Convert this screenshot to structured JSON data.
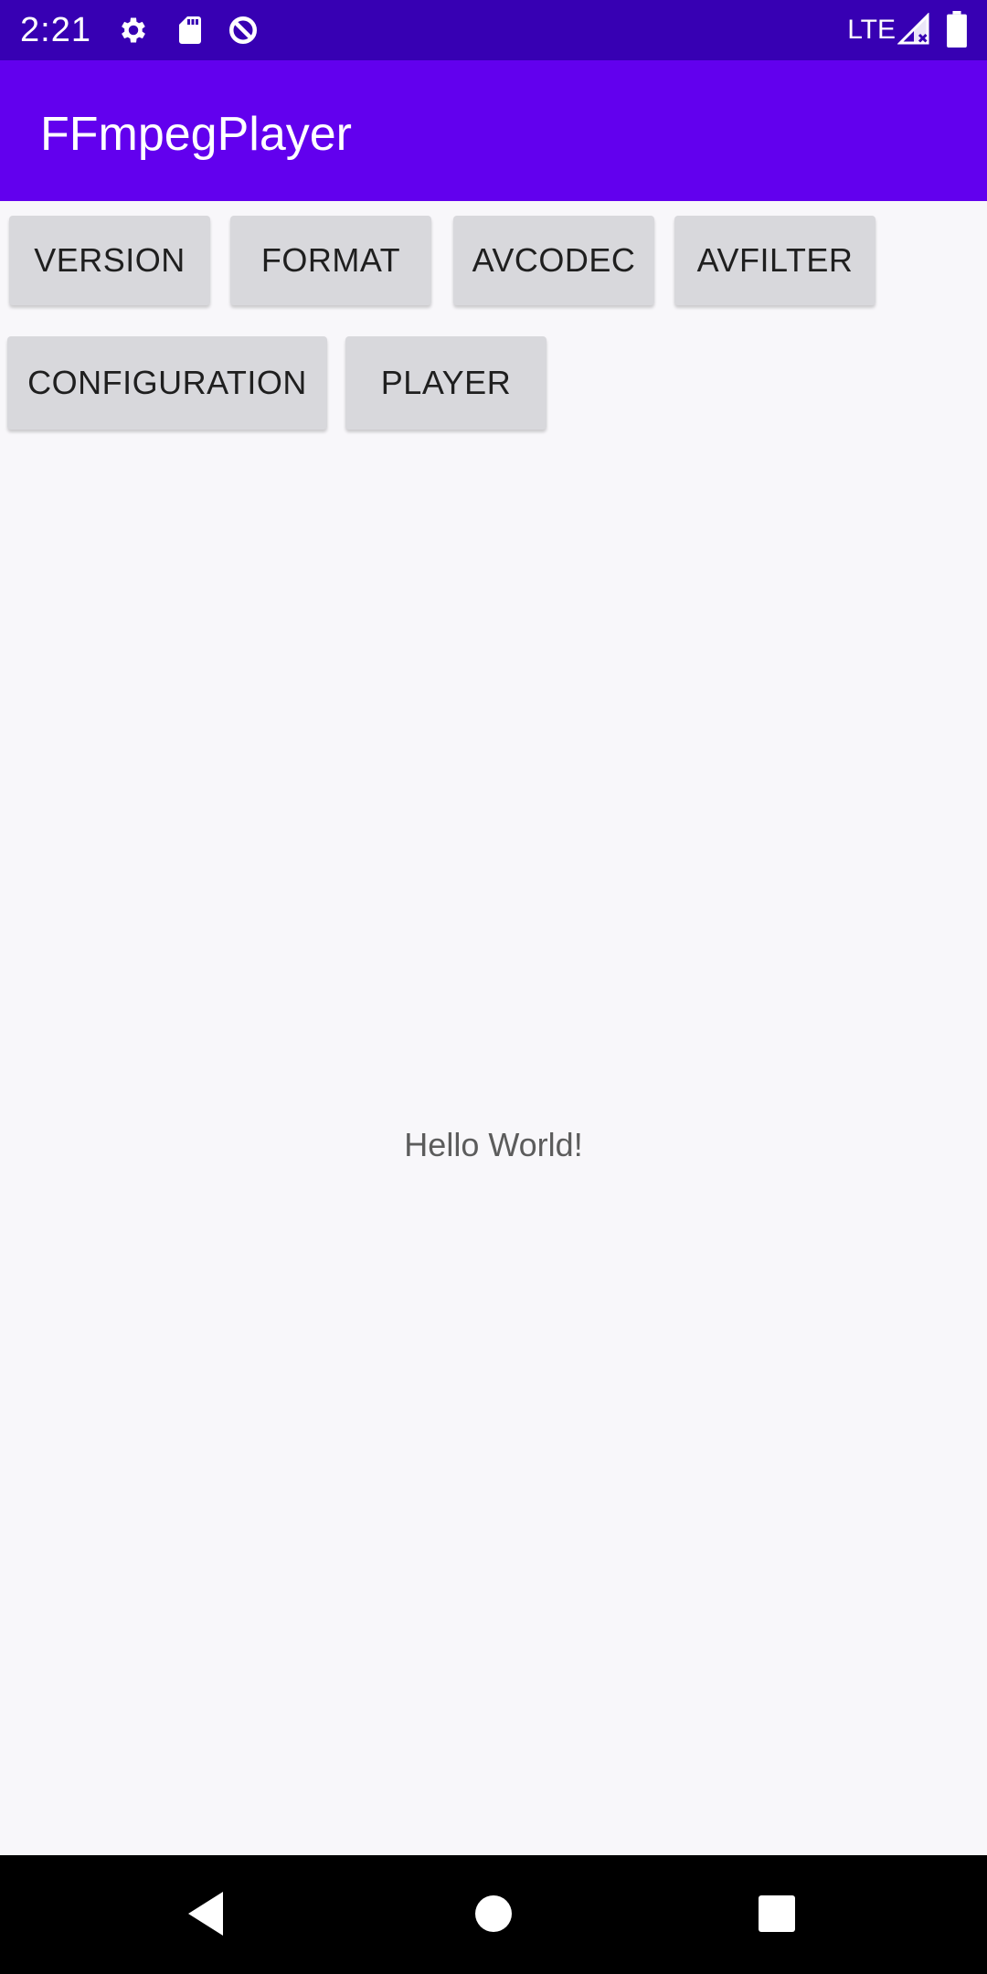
{
  "status_bar": {
    "time": "2:21",
    "network": "LTE",
    "icons": [
      "gear-icon",
      "sd-card-icon",
      "data-saver-icon",
      "signal-icon",
      "battery-icon"
    ]
  },
  "app_bar": {
    "title": "FFmpegPlayer",
    "color": "#6200ee"
  },
  "buttons": {
    "version": "VERSION",
    "format": "FORMAT",
    "avcodec": "AVCODEC",
    "avfilter": "AVFILTER",
    "configuration": "CONFIGURATION",
    "player": "PLAYER"
  },
  "main": {
    "message": "Hello World!"
  },
  "nav_bar": {
    "icons": [
      "back-icon",
      "home-icon",
      "recents-icon"
    ]
  }
}
